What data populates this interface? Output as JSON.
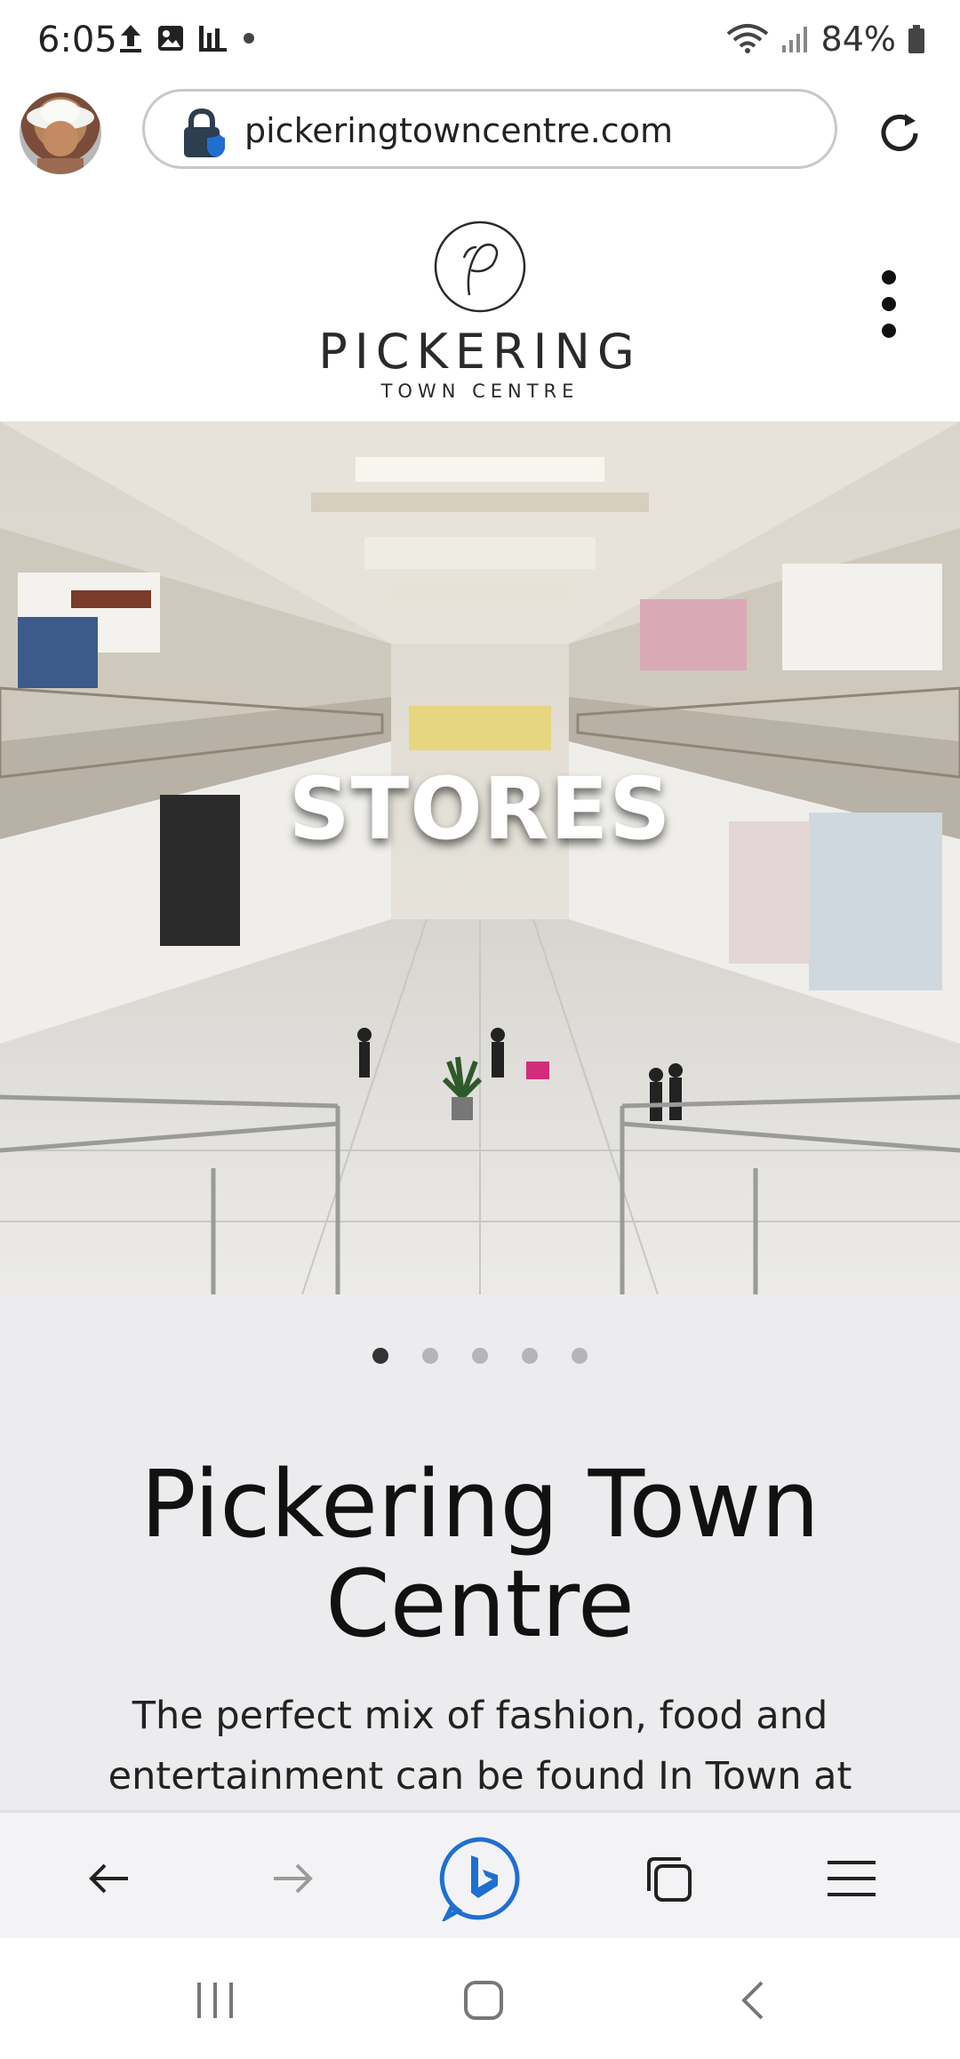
{
  "status_bar": {
    "time": "6:05",
    "battery": "84%",
    "icons": [
      "upload-icon",
      "image-icon",
      "bar-chart-icon",
      "dot-icon",
      "wifi-icon",
      "signal-icon",
      "battery-icon"
    ]
  },
  "browser": {
    "url": "pickeringtowncentre.com",
    "icons": [
      "avatar",
      "lock-icon",
      "reload-icon"
    ]
  },
  "site": {
    "logo_title": "PICKERING",
    "logo_subtitle": "TOWN CENTRE",
    "menu_icon": "kebab-menu-icon"
  },
  "hero": {
    "title": "STORES",
    "slides_total": 5,
    "active_slide": 1
  },
  "content": {
    "title": "Pickering Town Centre",
    "description": "The perfect mix of fashion, food and entertainment can be found In Town at"
  },
  "bottom_toolbar": {
    "items": [
      "back-icon",
      "forward-icon",
      "bing-chat-icon",
      "tabs-icon",
      "menu-icon"
    ]
  },
  "colors": {
    "accent": "#1f6fd1",
    "content_bg": "#ececee"
  }
}
